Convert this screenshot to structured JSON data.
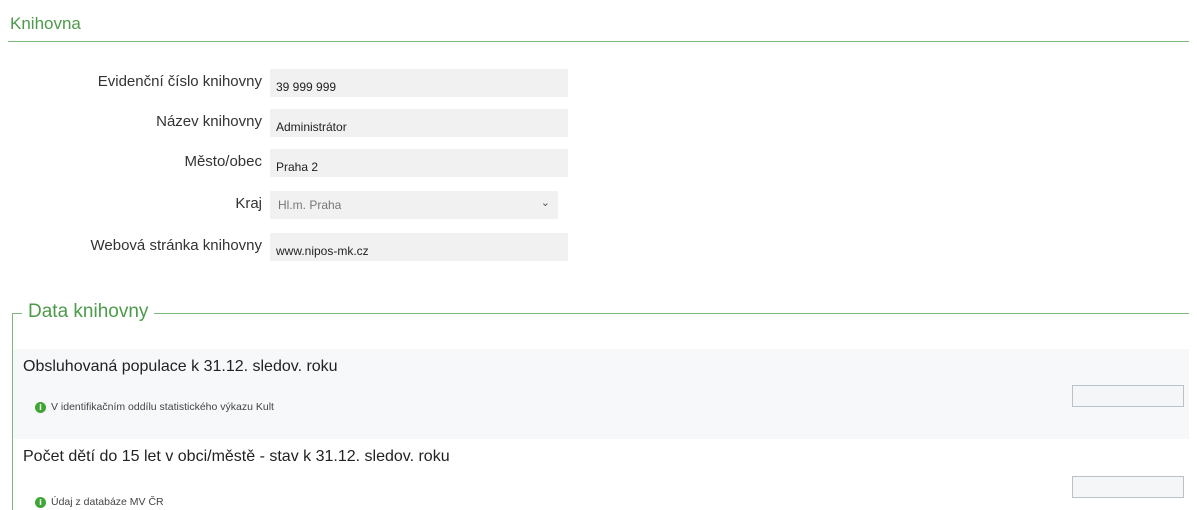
{
  "section": {
    "title": "Knihovna"
  },
  "library_form": {
    "fields": [
      {
        "label": "Evidenční číslo knihovny",
        "value": "39 999 999"
      },
      {
        "label": "Název knihovny",
        "value": "Administrátor"
      },
      {
        "label": "Město/obec",
        "value": "Praha 2"
      },
      {
        "label": "Kraj",
        "value": "Hl.m. Praha"
      },
      {
        "label": "Webová stránka knihovny",
        "value": "www.nipos-mk.cz"
      }
    ]
  },
  "data_section": {
    "legend": "Data knihovny",
    "items": [
      {
        "title": "Obsluhovaná populace k 31.12. sledov. roku",
        "hint": "V identifikačním oddílu statistického výkazu Kult",
        "value": ""
      },
      {
        "title": "Počet dětí do 15 let v obci/městě - stav k 31.12. sledov. roku",
        "hint": "Údaj z databáze MV ČR",
        "value": ""
      }
    ]
  },
  "icons": {
    "info": "info-circle-icon",
    "select": "chevron-down-icon"
  },
  "colors": {
    "accent_green": "#4d9a4a",
    "info_green": "#3fa535",
    "field_bg": "#f1f1f1"
  }
}
